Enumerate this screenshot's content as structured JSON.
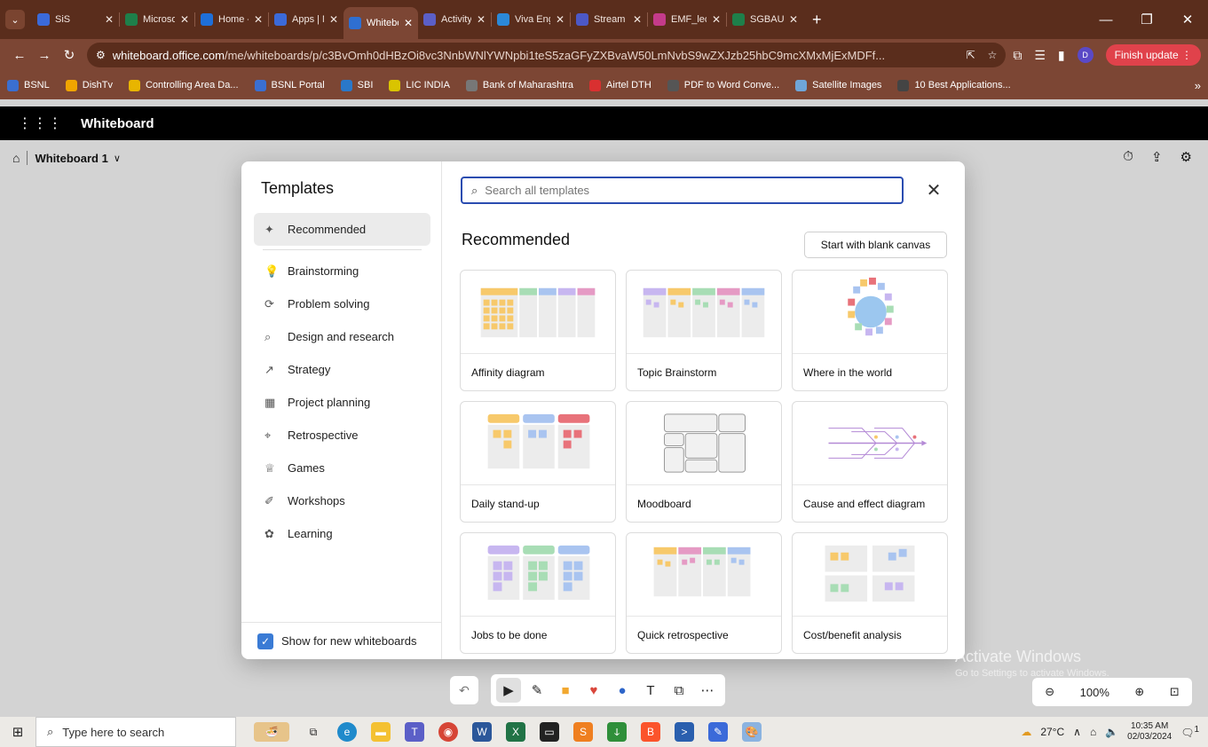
{
  "browser": {
    "tabs": [
      {
        "title": "SiS",
        "color": "#3b6ad9"
      },
      {
        "title": "Microsof",
        "color": "#1e7f4a"
      },
      {
        "title": "Home - (",
        "color": "#1e6fd9"
      },
      {
        "title": "Apps | M",
        "color": "#3b6ad9"
      },
      {
        "title": "Whitebo",
        "color": "#2f6fd1",
        "active": true
      },
      {
        "title": "Activity",
        "color": "#5b5fc7"
      },
      {
        "title": "Viva Eng",
        "color": "#2b88d8"
      },
      {
        "title": "Stream |",
        "color": "#4c58c6"
      },
      {
        "title": "EMF_lect",
        "color": "#c43b8a"
      },
      {
        "title": "SGBAU E",
        "color": "#1e7f4a"
      }
    ],
    "url_domain": "whiteboard.office.com",
    "url_rest": "/me/whiteboards/p/c3BvOmh0dHBzOi8vc3NnbWNlYWNpbi1teS5zaGFyZXBvaW50LmNvbS9wZXJzb25hbC9mcXMxMjExMDFf...",
    "profile_initial": "D",
    "finish_update": "Finish update",
    "bookmarks": [
      {
        "label": "BSNL",
        "color": "#3a6fd1"
      },
      {
        "label": "DishTv",
        "color": "#f0a500"
      },
      {
        "label": "Controlling Area Da...",
        "color": "#e8b500"
      },
      {
        "label": "BSNL Portal",
        "color": "#3a6fd1"
      },
      {
        "label": "SBI",
        "color": "#2a78c9"
      },
      {
        "label": "LIC INDIA",
        "color": "#d9c400"
      },
      {
        "label": "Bank of Maharashtra",
        "color": "#777777"
      },
      {
        "label": "Airtel DTH",
        "color": "#d93030"
      },
      {
        "label": "PDF to Word Conve...",
        "color": "#555555"
      },
      {
        "label": "Satellite Images",
        "color": "#6fa6d9"
      },
      {
        "label": "10 Best Applications...",
        "color": "#444444"
      }
    ]
  },
  "app": {
    "name": "Whiteboard",
    "board_title": "Whiteboard 1"
  },
  "templates": {
    "heading": "Templates",
    "search_placeholder": "Search all templates",
    "section_title": "Recommended",
    "blank_button": "Start with blank canvas",
    "show_for_new": "Show for new whiteboards",
    "categories": [
      {
        "label": "Recommended",
        "icon": "sparkle-icon",
        "selected": true
      },
      {
        "label": "Brainstorming",
        "icon": "lightbulb-icon"
      },
      {
        "label": "Problem solving",
        "icon": "puzzle-icon"
      },
      {
        "label": "Design and research",
        "icon": "magnifier-icon"
      },
      {
        "label": "Strategy",
        "icon": "chart-icon"
      },
      {
        "label": "Project planning",
        "icon": "calendar-icon"
      },
      {
        "label": "Retrospective",
        "icon": "rocket-icon"
      },
      {
        "label": "Games",
        "icon": "trophy-icon"
      },
      {
        "label": "Workshops",
        "icon": "wrench-icon"
      },
      {
        "label": "Learning",
        "icon": "brain-icon"
      }
    ],
    "cards": [
      {
        "label": "Affinity diagram",
        "preview": "affinity"
      },
      {
        "label": "Topic Brainstorm",
        "preview": "topic"
      },
      {
        "label": "Where in the world",
        "preview": "world"
      },
      {
        "label": "Daily stand-up",
        "preview": "standup"
      },
      {
        "label": "Moodboard",
        "preview": "moodboard"
      },
      {
        "label": "Cause and effect diagram",
        "preview": "fishbone"
      },
      {
        "label": "Jobs to be done",
        "preview": "jobs"
      },
      {
        "label": "Quick retrospective",
        "preview": "retro"
      },
      {
        "label": "Cost/benefit analysis",
        "preview": "costbenefit"
      }
    ]
  },
  "canvas": {
    "zoom": "100%",
    "tools": [
      "undo-icon",
      "select-icon",
      "pen-icon",
      "note-icon",
      "reaction-icon",
      "shape-icon",
      "text-icon",
      "link-icon",
      "more-icon"
    ]
  },
  "watermark": {
    "line1": "Activate Windows",
    "line2": "Go to Settings to activate Windows."
  },
  "taskbar": {
    "search_placeholder": "Type here to search",
    "weather": "27°C",
    "time": "10:35 AM",
    "date": "02/03/2024",
    "notifications": "1"
  },
  "colors": {
    "tabstrip": "#5a2d1c",
    "chrome": "#7c4634",
    "accent": "#2a4cb0",
    "checkbox": "#3a7bd5"
  }
}
